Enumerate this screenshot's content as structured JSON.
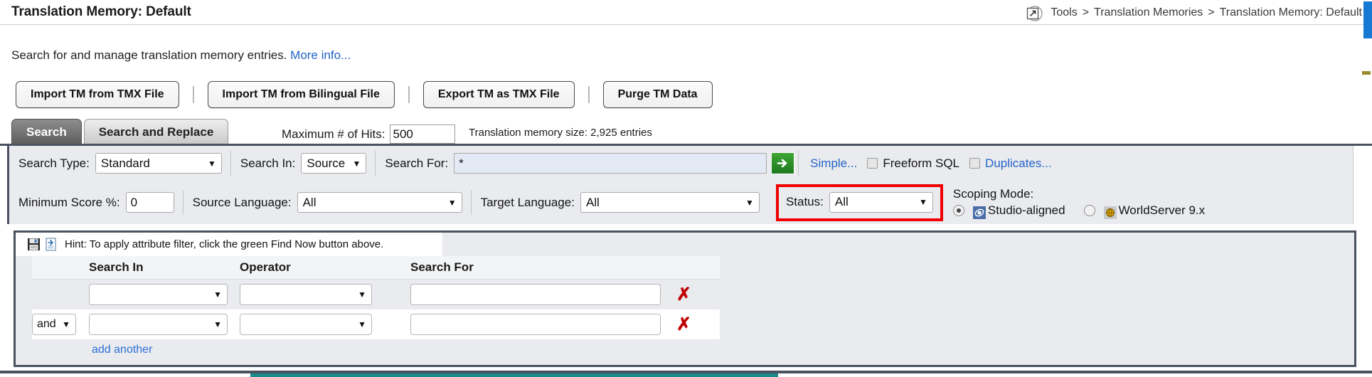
{
  "header": {
    "title": "Translation Memory: Default",
    "popout_icon": "popout-window-icon",
    "breadcrumb": {
      "items": [
        "Tools",
        "Translation Memories",
        "Translation Memory: Default"
      ],
      "separator": ">"
    }
  },
  "description": {
    "text": "Search for and manage translation memory entries.",
    "more_info_label": "More info..."
  },
  "toolbar": {
    "buttons": [
      "Import TM from TMX File",
      "Import TM from Bilingual File",
      "Export TM as TMX File",
      "Purge TM Data"
    ]
  },
  "tabs": [
    {
      "label": "Search",
      "active": true
    },
    {
      "label": "Search and Replace",
      "active": false
    }
  ],
  "hits": {
    "label": "Maximum # of Hits:",
    "value": "500"
  },
  "tm_size_text": "Translation memory size: 2,925 entries",
  "search_row": {
    "search_type": {
      "label": "Search Type:",
      "value": "Standard"
    },
    "search_in": {
      "label": "Search In:",
      "value": "Source"
    },
    "search_for": {
      "label": "Search For:",
      "value": "*"
    },
    "find_now_icon": "green-arrow-find-now-icon",
    "simple_link": "Simple...",
    "freeform_sql_label": "Freeform SQL",
    "freeform_sql_checked": false,
    "duplicates_link": "Duplicates...",
    "duplicates_checked": false
  },
  "filter_row": {
    "minimum_score": {
      "label": "Minimum Score %:",
      "value": "0"
    },
    "source_language": {
      "label": "Source Language:",
      "value": "All"
    },
    "target_language": {
      "label": "Target Language:",
      "value": "All"
    },
    "status": {
      "label": "Status:",
      "value": "All",
      "highlight_color": "#f00000"
    },
    "scoping_mode": {
      "label": "Scoping Mode:",
      "options": [
        {
          "label": "Studio-aligned",
          "selected": true,
          "icon": "studio-aligned-icon"
        },
        {
          "label": "WorldServer 9.x",
          "selected": false,
          "icon": "worldserver-icon"
        }
      ]
    }
  },
  "attribute_filter": {
    "save_icon": "save-disk-icon",
    "load_icon": "load-document-icon",
    "hint": "Hint: To apply attribute filter, click the green Find Now button above.",
    "columns": [
      "",
      "Search In",
      "Operator",
      "Search For"
    ],
    "rows": [
      {
        "conjunction": "",
        "search_in": "",
        "operator": "",
        "search_for": "",
        "delete_icon": "delete-x-icon"
      },
      {
        "conjunction": "and",
        "search_in": "",
        "operator": "",
        "search_for": "",
        "delete_icon": "delete-x-icon"
      }
    ],
    "add_another_label": "add another"
  },
  "colors": {
    "accent_blue": "#1679d4",
    "panel_bg": "#e9ebee",
    "border_dark": "#4a5260",
    "highlight_red": "#f00000",
    "teal": "#1b8a8a",
    "link": "#2464c8"
  }
}
